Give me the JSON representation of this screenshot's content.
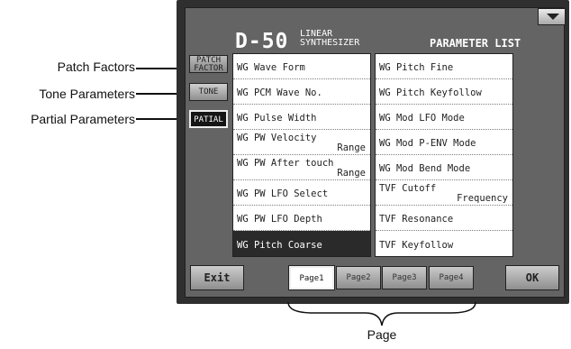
{
  "callouts": {
    "patch_factors": "Patch Factors",
    "tone_parameters": "Tone Parameters",
    "partial_parameters": "Partial Parameters",
    "page": "Page"
  },
  "screen": {
    "logo": "D-50",
    "logo_sub_line1": "LINEAR",
    "logo_sub_line2": "SYNTHESIZER",
    "title": "PARAMETER LIST",
    "pulldown_icon": "chevron-down-icon"
  },
  "side_tabs": {
    "patch_factor_line1": "PATCH",
    "patch_factor_line2": "FACTOR",
    "tone": "TONE",
    "partial": "PATIAL"
  },
  "params_left": [
    {
      "line1": "WG Wave Form",
      "line2": ""
    },
    {
      "line1": "WG PCM Wave No.",
      "line2": ""
    },
    {
      "line1": "WG Pulse Width",
      "line2": ""
    },
    {
      "line1": "WG PW Velocity",
      "line2": "Range"
    },
    {
      "line1": "WG PW After touch",
      "line2": "Range"
    },
    {
      "line1": "WG PW LFO Select",
      "line2": ""
    },
    {
      "line1": "WG PW LFO Depth",
      "line2": ""
    },
    {
      "line1": "WG Pitch Coarse",
      "line2": ""
    }
  ],
  "params_right": [
    {
      "line1": "WG Pitch Fine",
      "line2": ""
    },
    {
      "line1": "WG Pitch Keyfollow",
      "line2": ""
    },
    {
      "line1": "WG Mod LFO Mode",
      "line2": ""
    },
    {
      "line1": "WG Mod P-ENV Mode",
      "line2": ""
    },
    {
      "line1": "WG Mod Bend Mode",
      "line2": ""
    },
    {
      "line1": "TVF Cutoff",
      "line2": "Frequency"
    },
    {
      "line1": "TVF Resonance",
      "line2": ""
    },
    {
      "line1": "TVF Keyfollow",
      "line2": ""
    }
  ],
  "selected_param": "WG Pitch Coarse",
  "buttons": {
    "exit": "Exit",
    "ok": "OK"
  },
  "pages": [
    "Page1",
    "Page2",
    "Page3",
    "Page4"
  ],
  "active_page": "Page1"
}
